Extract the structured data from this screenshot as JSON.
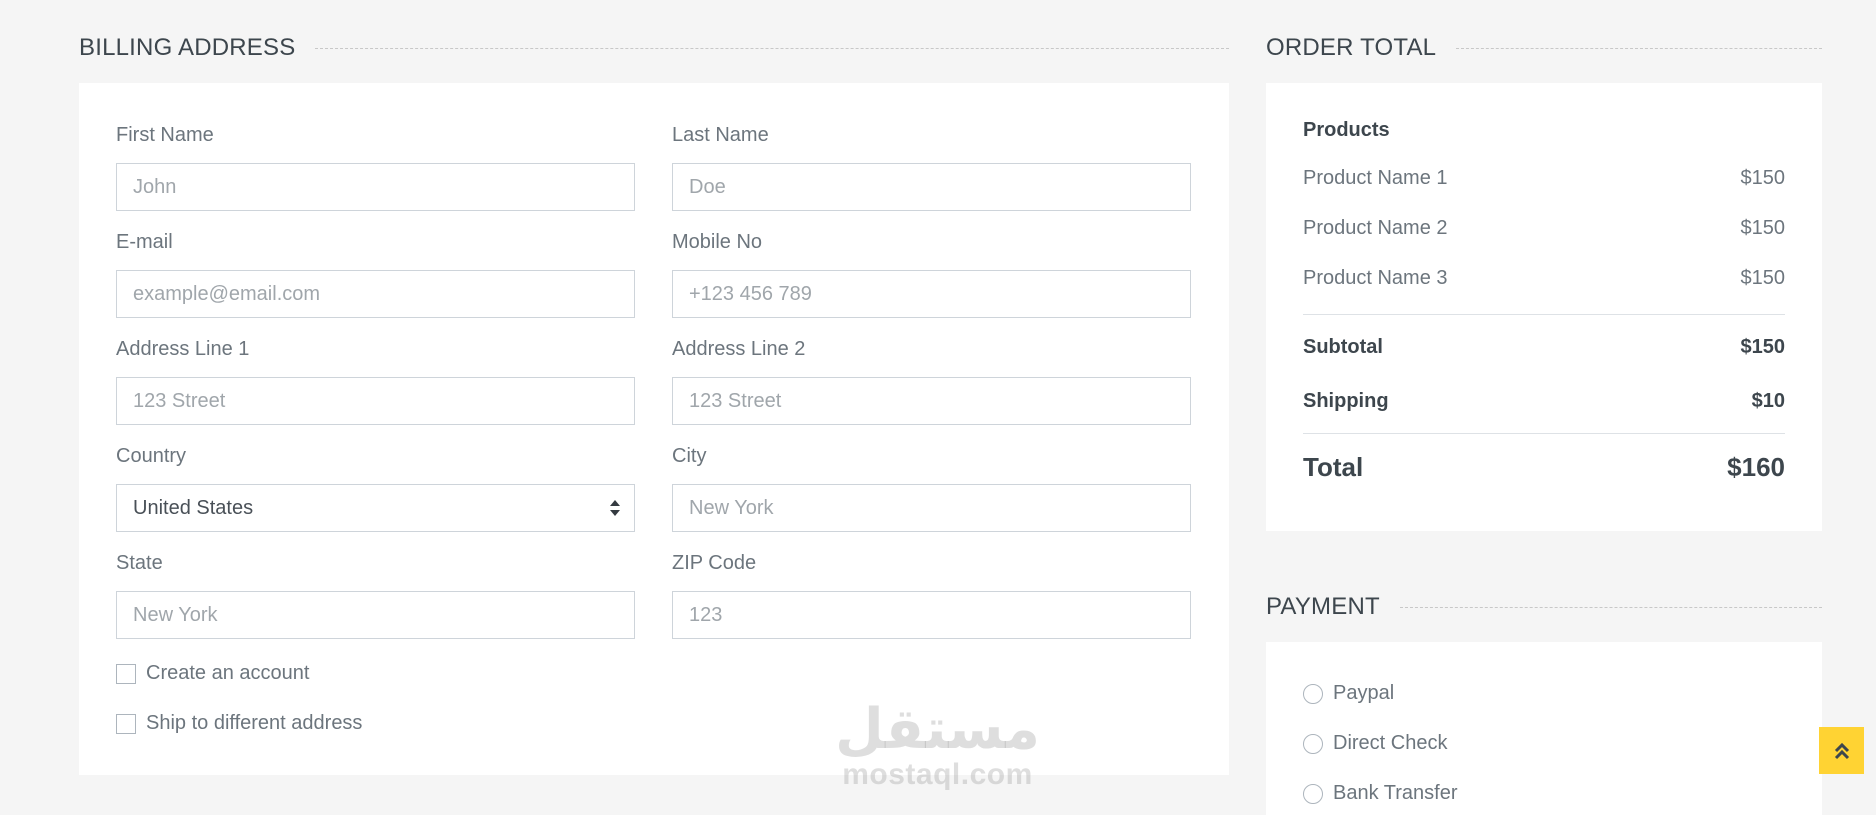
{
  "billing": {
    "title": "BILLING ADDRESS",
    "fields": {
      "first_name": {
        "label": "First Name",
        "placeholder": "John"
      },
      "last_name": {
        "label": "Last Name",
        "placeholder": "Doe"
      },
      "email": {
        "label": "E-mail",
        "placeholder": "example@email.com"
      },
      "mobile": {
        "label": "Mobile No",
        "placeholder": "+123 456 789"
      },
      "address1": {
        "label": "Address Line 1",
        "placeholder": "123 Street"
      },
      "address2": {
        "label": "Address Line 2",
        "placeholder": "123 Street"
      },
      "country": {
        "label": "Country",
        "value": "United States"
      },
      "city": {
        "label": "City",
        "placeholder": "New York"
      },
      "state": {
        "label": "State",
        "placeholder": "New York"
      },
      "zip": {
        "label": "ZIP Code",
        "placeholder": "123"
      }
    },
    "checkboxes": {
      "create_account": "Create an account",
      "ship_different": "Ship to different address"
    }
  },
  "order": {
    "title": "ORDER TOTAL",
    "products_heading": "Products",
    "products": [
      {
        "name": "Product Name 1",
        "price": "$150"
      },
      {
        "name": "Product Name 2",
        "price": "$150"
      },
      {
        "name": "Product Name 3",
        "price": "$150"
      }
    ],
    "subtotal": {
      "label": "Subtotal",
      "value": "$150"
    },
    "shipping": {
      "label": "Shipping",
      "value": "$10"
    },
    "total": {
      "label": "Total",
      "value": "$160"
    }
  },
  "payment": {
    "title": "PAYMENT",
    "options": [
      "Paypal",
      "Direct Check",
      "Bank Transfer"
    ]
  },
  "watermark": {
    "arabic": "مستقل",
    "latin": "mostaql.com"
  },
  "colors": {
    "accent": "#ffd333",
    "background": "#f5f5f5",
    "heading": "#3d464d",
    "text": "#6c757d"
  },
  "icons": {
    "back_to_top": "double-chevron-up-icon"
  }
}
